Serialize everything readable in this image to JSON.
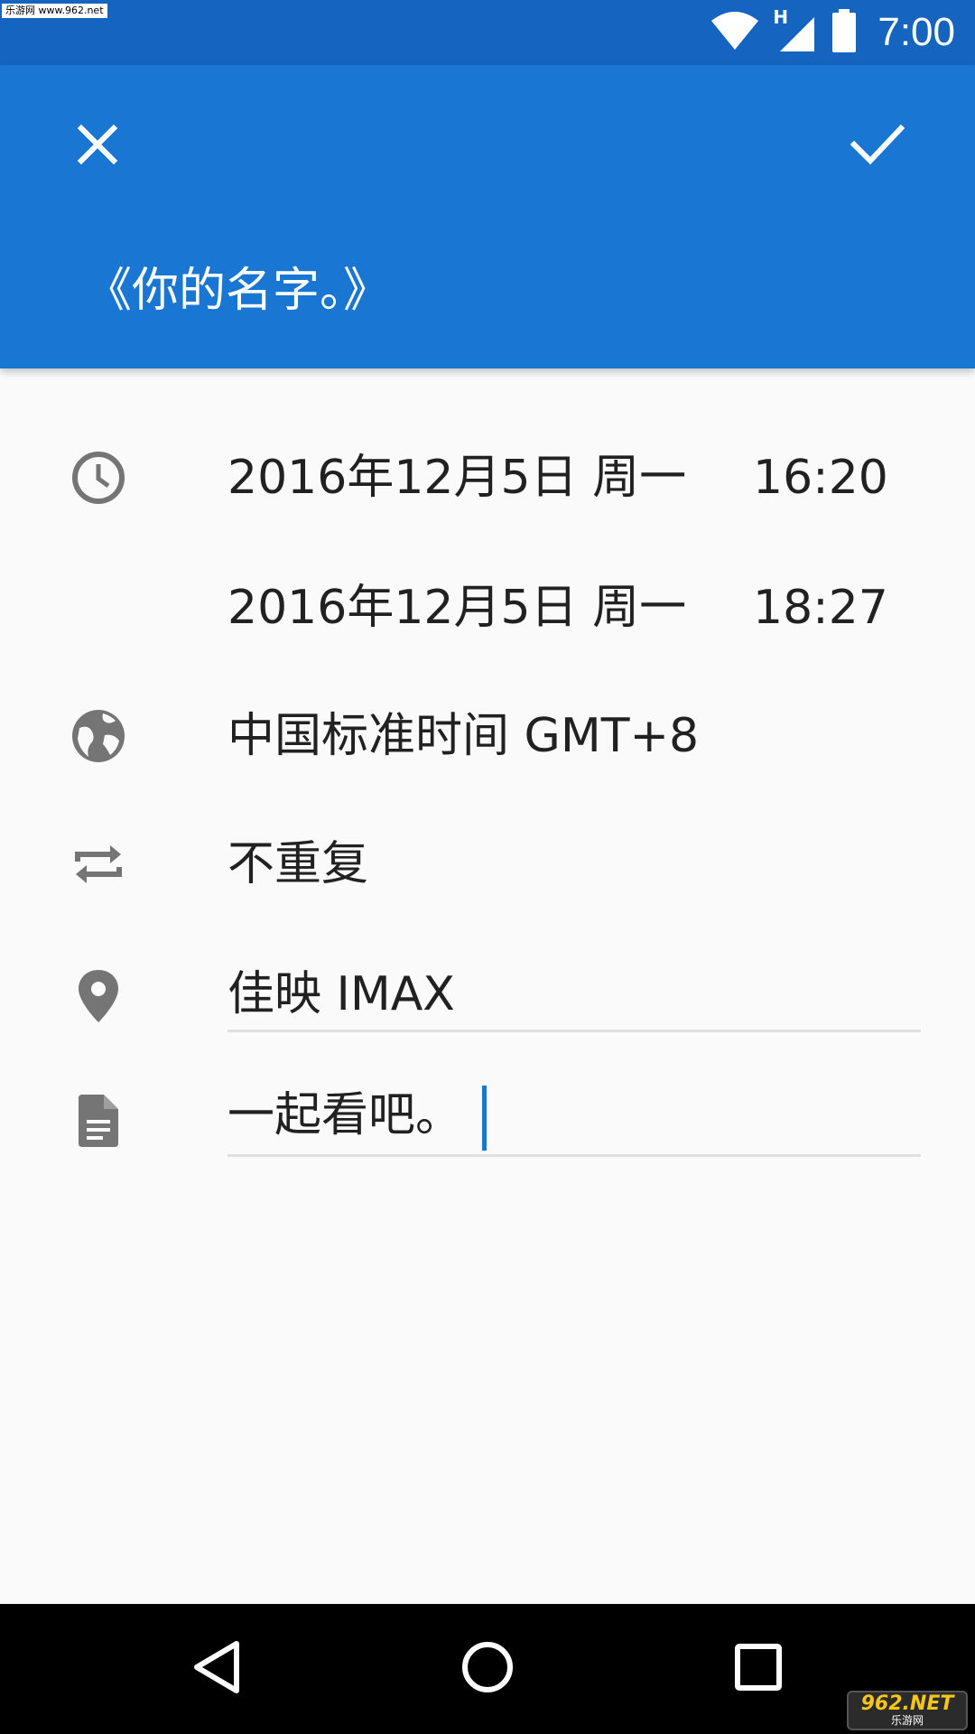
{
  "status_bar": {
    "watermark": "乐游网 www.962.net",
    "network_type": "H",
    "time": "7:00",
    "icons": [
      "wifi-icon",
      "cell-signal-icon",
      "battery-icon"
    ]
  },
  "app_bar": {
    "close_icon": "close-icon",
    "done_icon": "check-icon",
    "title": "《你的名字。》",
    "color": "#1976d2"
  },
  "event": {
    "start": {
      "date": "2016年12月5日 周一",
      "time": "16:20"
    },
    "end": {
      "date": "2016年12月5日 周一",
      "time": "18:27"
    },
    "timezone": "中国标准时间  GMT+8",
    "repeat": "不重复",
    "location": "佳映 IMAX",
    "description": "一起看吧。"
  },
  "row_icons": {
    "time": "clock-icon",
    "timezone": "globe-icon",
    "repeat": "repeat-icon",
    "location": "location-pin-icon",
    "description": "note-icon"
  },
  "nav_bar": {
    "buttons": [
      "back-icon",
      "home-icon",
      "recents-icon"
    ],
    "watermark_main": "962.NET",
    "watermark_sub": "乐游网"
  }
}
